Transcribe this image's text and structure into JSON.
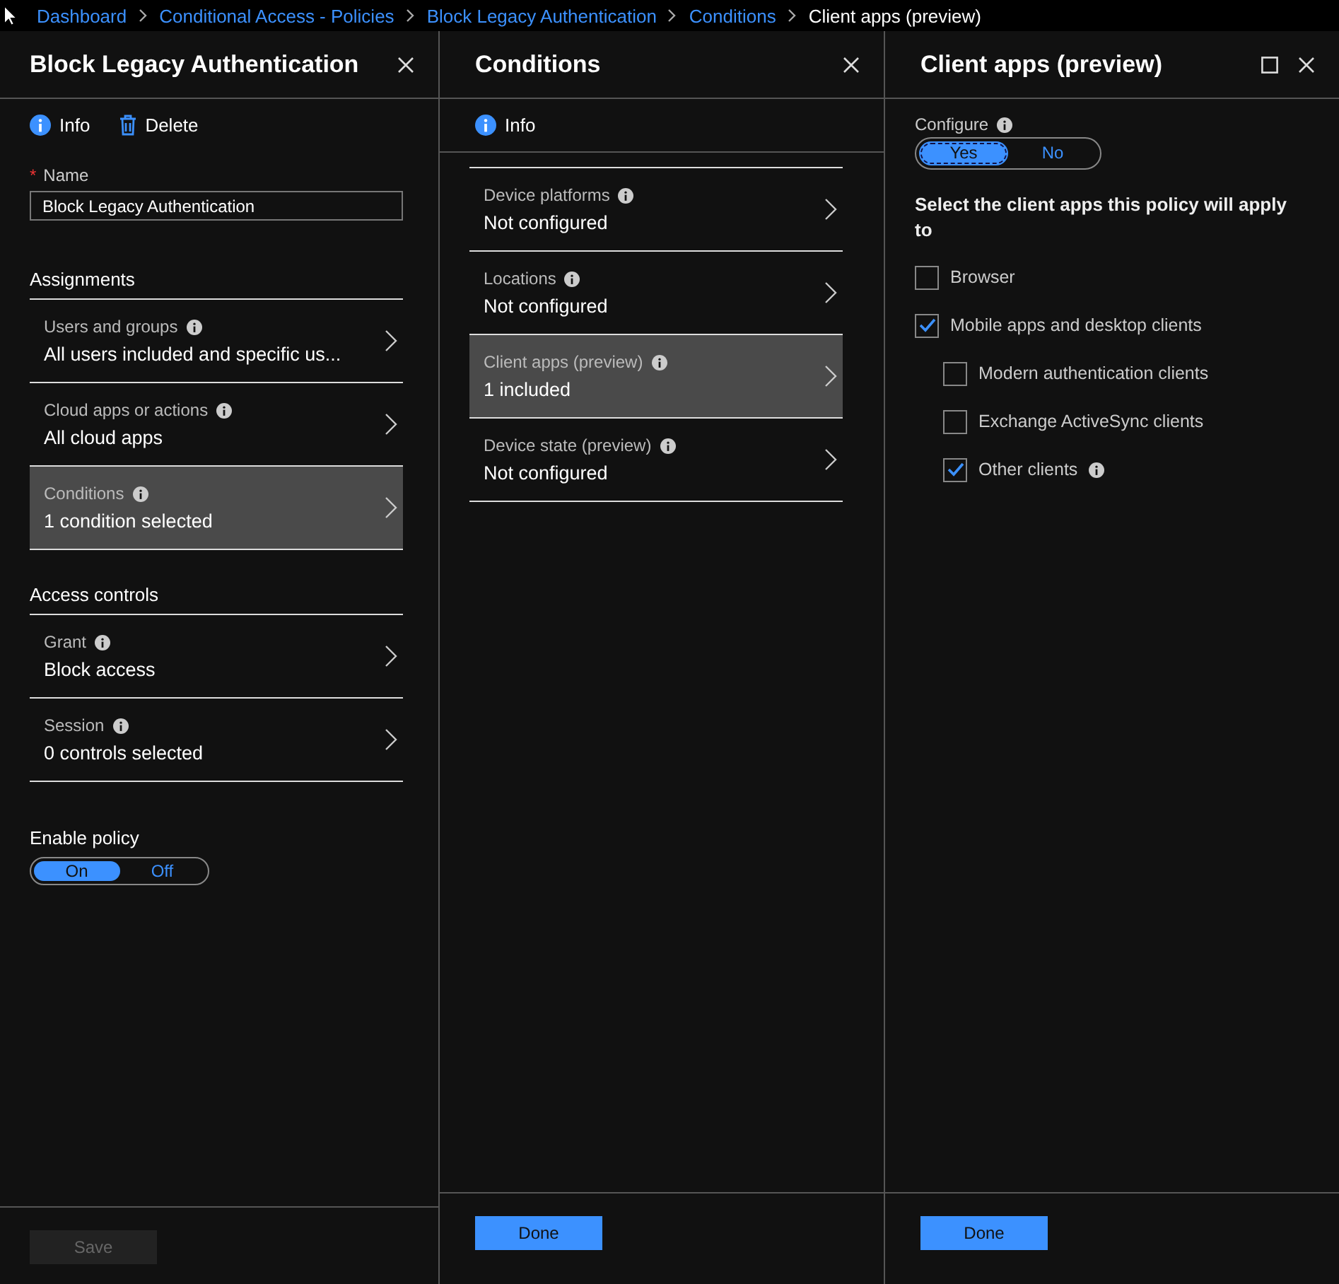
{
  "breadcrumb": [
    {
      "label": "Dashboard",
      "current": false
    },
    {
      "label": "Conditional Access - Policies",
      "current": false
    },
    {
      "label": "Block Legacy Authentication",
      "current": false
    },
    {
      "label": "Conditions",
      "current": false
    },
    {
      "label": "Client apps (preview)",
      "current": true
    }
  ],
  "policy_panel": {
    "title": "Block Legacy Authentication",
    "toolbar": [
      {
        "label": "Info",
        "kind": "info"
      },
      {
        "label": "Delete",
        "kind": "delete"
      }
    ],
    "name_required_mark": "*",
    "name_label": "Name",
    "name_value": "Block Legacy Authentication",
    "sections": [
      {
        "heading": "Assignments",
        "items": [
          {
            "label": "Users and groups",
            "value": "All users included and specific us...",
            "info": true,
            "selected": false
          },
          {
            "label": "Cloud apps or actions",
            "value": "All cloud apps",
            "info": true,
            "selected": false
          },
          {
            "label": "Conditions",
            "value": "1 condition selected",
            "info": true,
            "selected": true
          }
        ]
      },
      {
        "heading": "Access controls",
        "items": [
          {
            "label": "Grant",
            "value": "Block access",
            "info": true,
            "selected": false
          },
          {
            "label": "Session",
            "value": "0 controls selected",
            "info": true,
            "selected": false
          }
        ]
      }
    ],
    "enable_label": "Enable policy",
    "enable_toggle": [
      {
        "label": "On",
        "selected": true
      },
      {
        "label": "Off",
        "selected": false
      }
    ],
    "save_button": {
      "label": "Save",
      "disabled": true
    }
  },
  "conditions_panel": {
    "title": "Conditions",
    "toolbar": [
      {
        "label": "Info",
        "kind": "info"
      }
    ],
    "items": [
      {
        "label": "Device platforms",
        "value": "Not configured",
        "info": true,
        "selected": false
      },
      {
        "label": "Locations",
        "value": "Not configured",
        "info": true,
        "selected": false
      },
      {
        "label": "Client apps (preview)",
        "value": "1 included",
        "info": true,
        "selected": true
      },
      {
        "label": "Device state (preview)",
        "value": "Not configured",
        "info": true,
        "selected": false
      }
    ],
    "done_button": "Done"
  },
  "client_apps_panel": {
    "title": "Client apps (preview)",
    "configure_label": "Configure",
    "configure_toggle": [
      {
        "label": "Yes",
        "selected": true
      },
      {
        "label": "No",
        "selected": false
      }
    ],
    "prompt": "Select the client apps this policy will apply to",
    "options": [
      {
        "label": "Browser",
        "checked": false,
        "info": false
      },
      {
        "label": "Mobile apps and desktop clients",
        "checked": true,
        "info": false,
        "children": [
          {
            "label": "Modern authentication clients",
            "checked": false,
            "info": false
          },
          {
            "label": "Exchange ActiveSync clients",
            "checked": false,
            "info": false
          },
          {
            "label": "Other clients",
            "checked": true,
            "info": true
          }
        ]
      }
    ],
    "done_button": "Done"
  }
}
